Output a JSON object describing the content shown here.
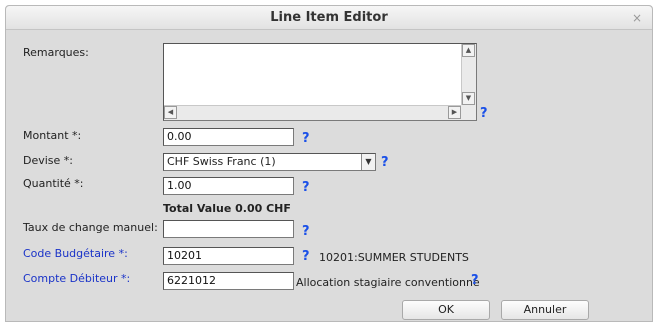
{
  "dialog": {
    "title": "Line Item Editor",
    "close_glyph": "×"
  },
  "form": {
    "remarques_label": "Remarques:",
    "remarques_value": "",
    "montant_label": "Montant *:",
    "montant_value": "0.00",
    "devise_label": "Devise *:",
    "devise_selected": "CHF Swiss Franc (1)",
    "quantite_label": "Quantité *:",
    "quantite_value": "1.00",
    "total_value": "Total Value 0.00 CHF",
    "taux_label": "Taux de change manuel:",
    "taux_value": "",
    "code_label": "Code Budgétaire *:",
    "code_value": "10201",
    "code_description": "10201:SUMMER STUDENTS",
    "compte_label": "Compte Débiteur *:",
    "compte_value": "6221012",
    "compte_description": "Allocation stagiaire conventionne",
    "help_glyph": "?"
  },
  "buttons": {
    "ok_label": "OK",
    "cancel_label": "Annuler"
  },
  "colors": {
    "link_label": "#1a33c8",
    "help_icon": "#1a50e8"
  }
}
